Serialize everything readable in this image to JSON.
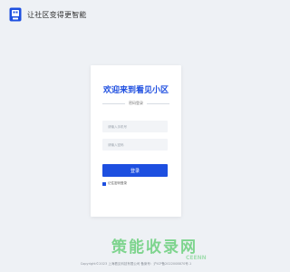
{
  "header": {
    "title": "让社区变得更智能",
    "logo_icon": "building-logo-icon"
  },
  "card": {
    "welcome": "欢迎来到看见小区",
    "section_label": "密码登录",
    "phone_placeholder": "请输入手机号",
    "password_placeholder": "请输入密码",
    "login_label": "登录",
    "remember_label": "记住密码登录"
  },
  "watermark": {
    "text": "策能收录网",
    "sub": "CEENN"
  },
  "footer": {
    "text": "Copyright©2023 上海看见科技有限公司 备案号：沪ICP备2022008870号-1"
  },
  "colors": {
    "brand": "#1d4fe0",
    "background": "#eef1f5",
    "watermark": "#34c24a"
  }
}
